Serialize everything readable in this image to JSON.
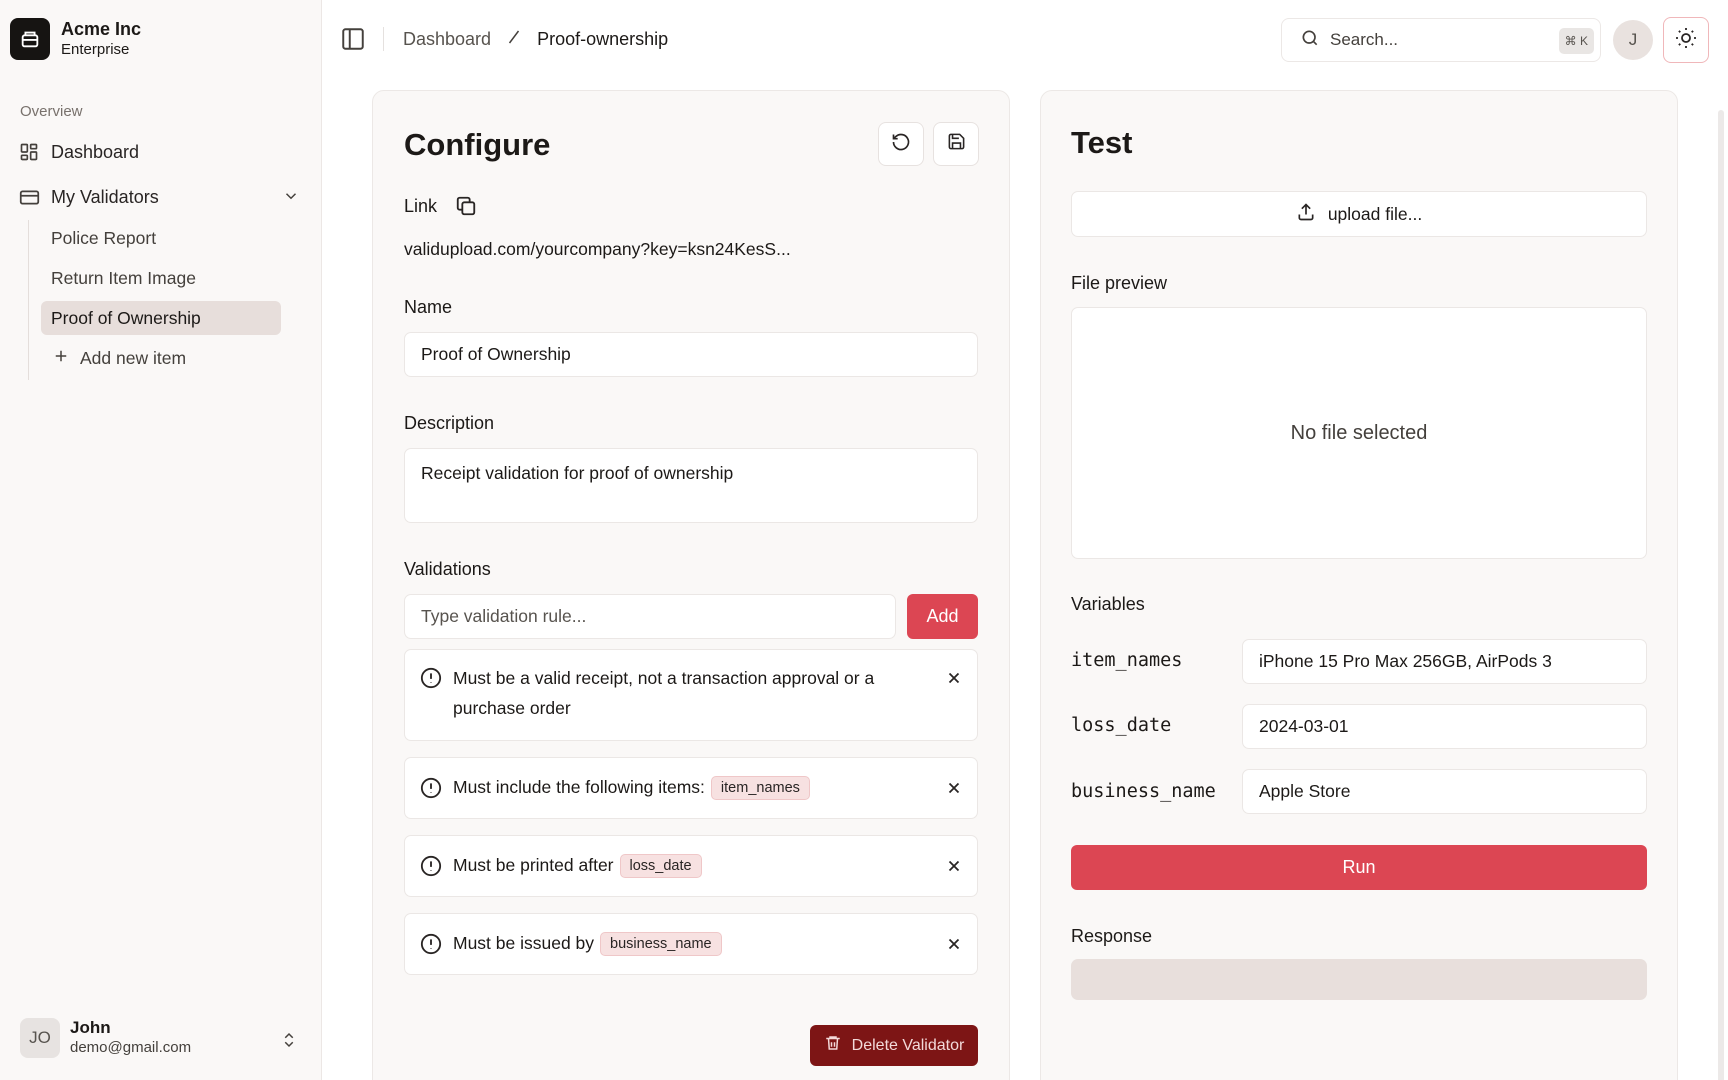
{
  "sidebar": {
    "brand_name": "Acme Inc",
    "brand_plan": "Enterprise",
    "section_label": "Overview",
    "items": [
      {
        "label": "Dashboard",
        "icon": "dashboard-icon"
      },
      {
        "label": "My Validators",
        "icon": "credit-card-icon",
        "expanded": true
      }
    ],
    "sub_items": [
      {
        "label": "Police Report",
        "active": false
      },
      {
        "label": "Return Item Image",
        "active": false
      },
      {
        "label": "Proof of Ownership",
        "active": true
      }
    ],
    "add_item_label": "Add new item",
    "user": {
      "initials": "JO",
      "name": "John",
      "email": "demo@gmail.com"
    }
  },
  "topbar": {
    "breadcrumb": [
      "Dashboard",
      "Proof-ownership"
    ],
    "search_placeholder": "Search...",
    "search_shortcut": "⌘ K",
    "avatar_initial": "J"
  },
  "configure": {
    "title": "Configure",
    "link_label": "Link",
    "link_value": "validupload.com/yourcompany?key=ksn24KesS...",
    "name_label": "Name",
    "name_value": "Proof of Ownership",
    "description_label": "Description",
    "description_value": "Receipt validation for proof of ownership",
    "validations_label": "Validations",
    "validation_placeholder": "Type validation rule...",
    "add_label": "Add",
    "rules": [
      {
        "text": "Must be a valid receipt, not a transaction approval or a purchase order",
        "tag": ""
      },
      {
        "text": "Must include the following items:",
        "tag": "item_names"
      },
      {
        "text": "Must be printed after",
        "tag": "loss_date"
      },
      {
        "text": "Must be issued by",
        "tag": "business_name"
      }
    ],
    "delete_label": "Delete Validator"
  },
  "test": {
    "title": "Test",
    "upload_label": "upload file...",
    "preview_label": "File preview",
    "preview_empty": "No file selected",
    "variables_label": "Variables",
    "variables": [
      {
        "name": "item_names",
        "value": "iPhone 15 Pro Max 256GB, AirPods 3"
      },
      {
        "name": "loss_date",
        "value": "2024-03-01"
      },
      {
        "name": "business_name",
        "value": "Apple Store"
      }
    ],
    "run_label": "Run",
    "response_label": "Response"
  },
  "colors": {
    "accent": "#dc4653",
    "danger_dark": "#7d1515",
    "active_bg": "#e7dedb",
    "tag_bg": "#f7e1e1"
  }
}
